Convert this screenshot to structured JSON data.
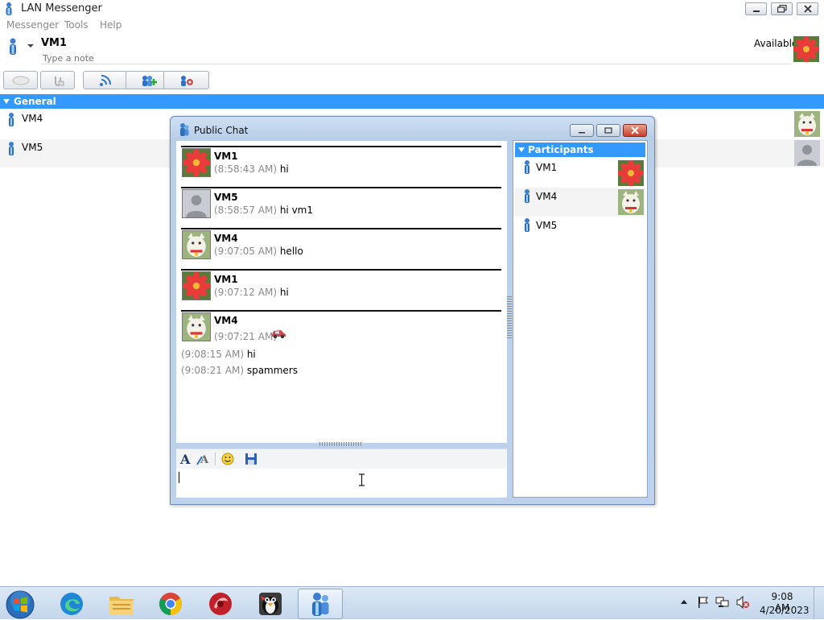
{
  "window": {
    "title": "LAN Messenger",
    "icons": {
      "app": "messenger-person-icon",
      "minimize": "minimize-icon",
      "maximize": "maximize-icon",
      "close": "close-icon"
    }
  },
  "menu": [
    "Messenger",
    "Tools",
    "Help"
  ],
  "profile": {
    "name": "VM1",
    "note_placeholder": "Type a note",
    "status": "Available",
    "avatar_icon": "flower-avatar"
  },
  "toolbar": {
    "buttons": [
      "chat-bubble-icon",
      "attach-paperclip-icon",
      "broadcast-icon",
      "add-contact-icon",
      "group-settings-icon"
    ]
  },
  "groups": [
    {
      "name": "General",
      "contacts": [
        {
          "name": "VM4",
          "avatar_icon": "lucky-cat-avatar"
        },
        {
          "name": "VM5",
          "avatar_icon": "default-person-avatar"
        }
      ]
    }
  ],
  "chat": {
    "title": "Public Chat",
    "messages": [
      {
        "sender": "VM1",
        "avatar_icon": "flower-avatar",
        "time": "(8:58:43 AM)",
        "text": "hi"
      },
      {
        "sender": "VM5",
        "avatar_icon": "default-person-avatar",
        "time": "(8:58:57 AM)",
        "text": "hi vm1"
      },
      {
        "sender": "VM4",
        "avatar_icon": "lucky-cat-avatar",
        "time": "(9:07:05 AM)",
        "text": "hello"
      },
      {
        "sender": "VM1",
        "avatar_icon": "flower-avatar",
        "time": "(9:07:12 AM)",
        "text": "hi"
      },
      {
        "sender": "VM4",
        "avatar_icon": "lucky-cat-avatar",
        "time": "(9:07:21 AM)",
        "text": "",
        "emoticon": "car-emoticon"
      }
    ],
    "continued_lines": [
      {
        "time": "(9:08:15 AM)",
        "text": "hi"
      },
      {
        "time": "(9:08:21 AM)",
        "text": "spammers"
      }
    ],
    "format_buttons": [
      "font-icon",
      "font-color-icon",
      "smiley-icon",
      "save-icon"
    ],
    "input_value": ""
  },
  "participants": {
    "header": "Participants",
    "list": [
      {
        "name": "VM1",
        "avatar_icon": "flower-avatar"
      },
      {
        "name": "VM4",
        "avatar_icon": "lucky-cat-avatar"
      },
      {
        "name": "VM5",
        "avatar_icon": ""
      }
    ]
  },
  "taskbar": {
    "apps": [
      "edge-icon",
      "file-explorer-icon",
      "chrome-icon",
      "red-app-icon",
      "penguin-app-icon",
      "lan-messenger-icon"
    ],
    "tray_icons": [
      "show-hidden-icons-arrow",
      "action-center-flag-icon",
      "network-icon",
      "volume-muted-icon"
    ],
    "time": "9:08 AM",
    "date": "4/20/2023"
  },
  "colors": {
    "accent": "#3399ff",
    "timestamp": "#8a8a8a",
    "menu_text": "#8a8a8a"
  }
}
